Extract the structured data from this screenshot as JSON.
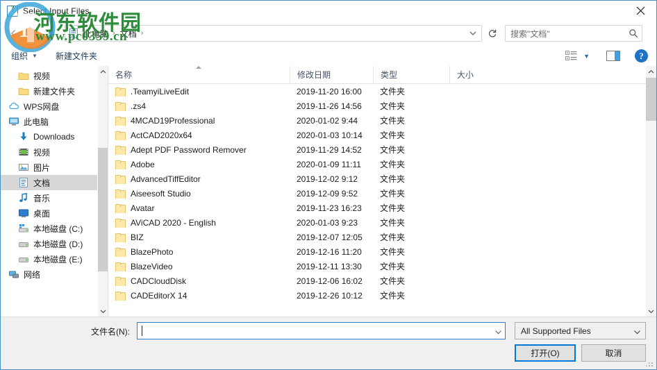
{
  "window": {
    "title": "Select Input Files",
    "app_icon": "question-app-icon",
    "close_icon": "close-icon"
  },
  "nav": {
    "back_icon": "chevron-left-icon",
    "forward_icon": "chevron-right-icon",
    "up_icon": "arrow-up-icon",
    "crumb_icon": "documents-icon",
    "breadcrumbs": [
      {
        "label": "此电脑"
      },
      {
        "label": "文档"
      }
    ],
    "separator": "›",
    "dropdown_icon": "chevron-down-icon",
    "refresh_icon": "refresh-icon"
  },
  "search": {
    "placeholder": "搜索\"文档\"",
    "icon": "search-icon"
  },
  "toolbar": {
    "organize_label": "组织",
    "organize_caret": "▼",
    "new_folder_label": "新建文件夹",
    "view_mode_icon": "list-view-icon",
    "view_caret": "▼",
    "preview_pane_icon": "preview-pane-icon",
    "help_label": "?"
  },
  "sidebar": {
    "items": [
      {
        "label": "视频",
        "icon": "folder-icon",
        "indent": 1,
        "selected": false
      },
      {
        "label": "新建文件夹",
        "icon": "folder-icon",
        "indent": 1,
        "selected": false
      },
      {
        "label": "WPS网盘",
        "icon": "cloud-icon",
        "indent": 0,
        "selected": false
      },
      {
        "label": "此电脑",
        "icon": "computer-icon",
        "indent": 0,
        "selected": false
      },
      {
        "label": "Downloads",
        "icon": "downloads-icon",
        "indent": 1,
        "selected": false
      },
      {
        "label": "视频",
        "icon": "videos-icon",
        "indent": 1,
        "selected": false
      },
      {
        "label": "图片",
        "icon": "pictures-icon",
        "indent": 1,
        "selected": false
      },
      {
        "label": "文档",
        "icon": "documents-icon",
        "indent": 1,
        "selected": true
      },
      {
        "label": "音乐",
        "icon": "music-icon",
        "indent": 1,
        "selected": false
      },
      {
        "label": "桌面",
        "icon": "desktop-icon",
        "indent": 1,
        "selected": false
      },
      {
        "label": "本地磁盘 (C:)",
        "icon": "system-drive-icon",
        "indent": 1,
        "selected": false
      },
      {
        "label": "本地磁盘 (D:)",
        "icon": "drive-icon",
        "indent": 1,
        "selected": false
      },
      {
        "label": "本地磁盘 (E:)",
        "icon": "drive-icon",
        "indent": 1,
        "selected": false
      },
      {
        "label": "网络",
        "icon": "network-icon",
        "indent": 0,
        "selected": false
      }
    ],
    "scroll_up_icon": "chevron-up-icon",
    "scroll_down_icon": "chevron-down-icon"
  },
  "filelist": {
    "columns": [
      {
        "key": "name",
        "label": "名称",
        "sorted": true
      },
      {
        "key": "date",
        "label": "修改日期",
        "sorted": false
      },
      {
        "key": "type",
        "label": "类型",
        "sorted": false
      },
      {
        "key": "size",
        "label": "大小",
        "sorted": false
      }
    ],
    "rows": [
      {
        "name": ".TeamyiLiveEdit",
        "date": "2019-11-20 16:00",
        "type": "文件夹",
        "size": "",
        "icon": "folder-icon"
      },
      {
        "name": ".zs4",
        "date": "2019-11-26 14:56",
        "type": "文件夹",
        "size": "",
        "icon": "folder-icon"
      },
      {
        "name": "4MCAD19Professional",
        "date": "2020-01-02 9:44",
        "type": "文件夹",
        "size": "",
        "icon": "folder-icon"
      },
      {
        "name": "ActCAD2020x64",
        "date": "2020-01-03 10:14",
        "type": "文件夹",
        "size": "",
        "icon": "folder-icon"
      },
      {
        "name": "Adept PDF Password Remover",
        "date": "2019-11-29 14:52",
        "type": "文件夹",
        "size": "",
        "icon": "folder-icon"
      },
      {
        "name": "Adobe",
        "date": "2020-01-09 11:11",
        "type": "文件夹",
        "size": "",
        "icon": "folder-icon"
      },
      {
        "name": "AdvancedTiffEditor",
        "date": "2019-12-02 9:12",
        "type": "文件夹",
        "size": "",
        "icon": "folder-icon"
      },
      {
        "name": "Aiseesoft Studio",
        "date": "2019-12-09 9:52",
        "type": "文件夹",
        "size": "",
        "icon": "folder-icon"
      },
      {
        "name": "Avatar",
        "date": "2019-11-23 16:23",
        "type": "文件夹",
        "size": "",
        "icon": "folder-icon"
      },
      {
        "name": "AViCAD 2020 - English",
        "date": "2020-01-03 9:23",
        "type": "文件夹",
        "size": "",
        "icon": "folder-icon"
      },
      {
        "name": "BIZ",
        "date": "2019-12-07 12:05",
        "type": "文件夹",
        "size": "",
        "icon": "folder-icon"
      },
      {
        "name": "BlazePhoto",
        "date": "2019-12-16 11:20",
        "type": "文件夹",
        "size": "",
        "icon": "folder-icon"
      },
      {
        "name": "BlazeVideo",
        "date": "2019-12-11 13:30",
        "type": "文件夹",
        "size": "",
        "icon": "folder-icon"
      },
      {
        "name": "CADCloudDisk",
        "date": "2019-12-06 16:02",
        "type": "文件夹",
        "size": "",
        "icon": "folder-icon"
      },
      {
        "name": "CADEditorX 14",
        "date": "2019-12-26 10:12",
        "type": "文件夹",
        "size": "",
        "icon": "folder-icon"
      }
    ]
  },
  "footer": {
    "filename_label": "文件名(N):",
    "filename_value": "",
    "filename_dropdown_icon": "chevron-down-icon",
    "filter_value": "All Supported Files",
    "filter_dropdown_icon": "chevron-down-icon",
    "open_label": "打开(O)",
    "cancel_label": "取消"
  },
  "watermark": {
    "line1": "河东软件园",
    "line2": "www.pc0359.cn",
    "color": "#2d8c3c"
  },
  "colors": {
    "accent": "#0078d7",
    "window_border": "#4a8ec2",
    "selection": "#d7d7d7",
    "header_text": "#44546a",
    "footer_bg": "#f0f0f0"
  }
}
